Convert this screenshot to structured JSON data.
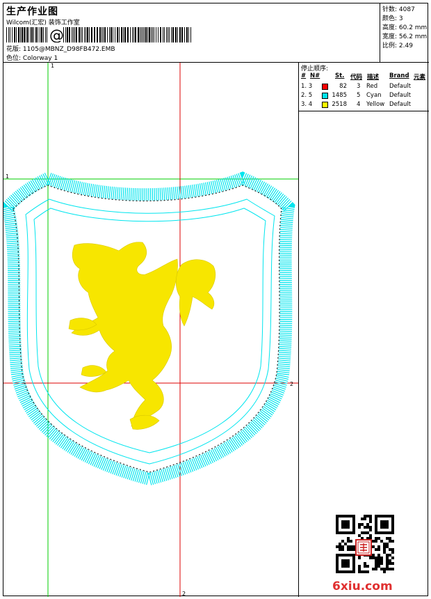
{
  "header": {
    "title": "生产作业图",
    "company": "Wilcom(汇宏) 装饰工作室",
    "design_label": "花版:",
    "design_value": "1105@MBNZ_D98FB472.EMB",
    "colorway_label": "色位:",
    "colorway_value": "Colorway 1"
  },
  "stats": {
    "stitches": "针数: 4087",
    "colors": "颜色: 3",
    "height": "高度: 60.2 mm",
    "width": "宽度: 56.2 mm",
    "scale": "比例: 2.49"
  },
  "canvas": {
    "marker_1_top": "1",
    "marker_1_left": "1",
    "marker_2_right": "2",
    "marker_2_bottom": "2",
    "colors": {
      "cyan": "#00e5ee",
      "yellow": "#f7e600",
      "green_guide": "#00cc00",
      "red_guide": "#dd0000"
    }
  },
  "sequence": {
    "title": "停止顺序:",
    "headers": {
      "num": "#",
      "n": "N#",
      "st": "St.",
      "code": "代码",
      "desc": "描述",
      "brand": "Brand",
      "element": "元素"
    },
    "rows": [
      {
        "num": "1. 3",
        "color": "#ff0000",
        "st": "82",
        "code": "3",
        "desc": "Red",
        "brand": "Default"
      },
      {
        "num": "2. 5",
        "color": "#00e5ee",
        "st": "1485",
        "code": "5",
        "desc": "Cyan",
        "brand": "Default"
      },
      {
        "num": "3. 4",
        "color": "#ffff00",
        "st": "2518",
        "code": "4",
        "desc": "Yellow",
        "brand": "Default"
      }
    ]
  },
  "footer": {
    "seal_text": "汇宏",
    "logo": "6xiu.com"
  }
}
